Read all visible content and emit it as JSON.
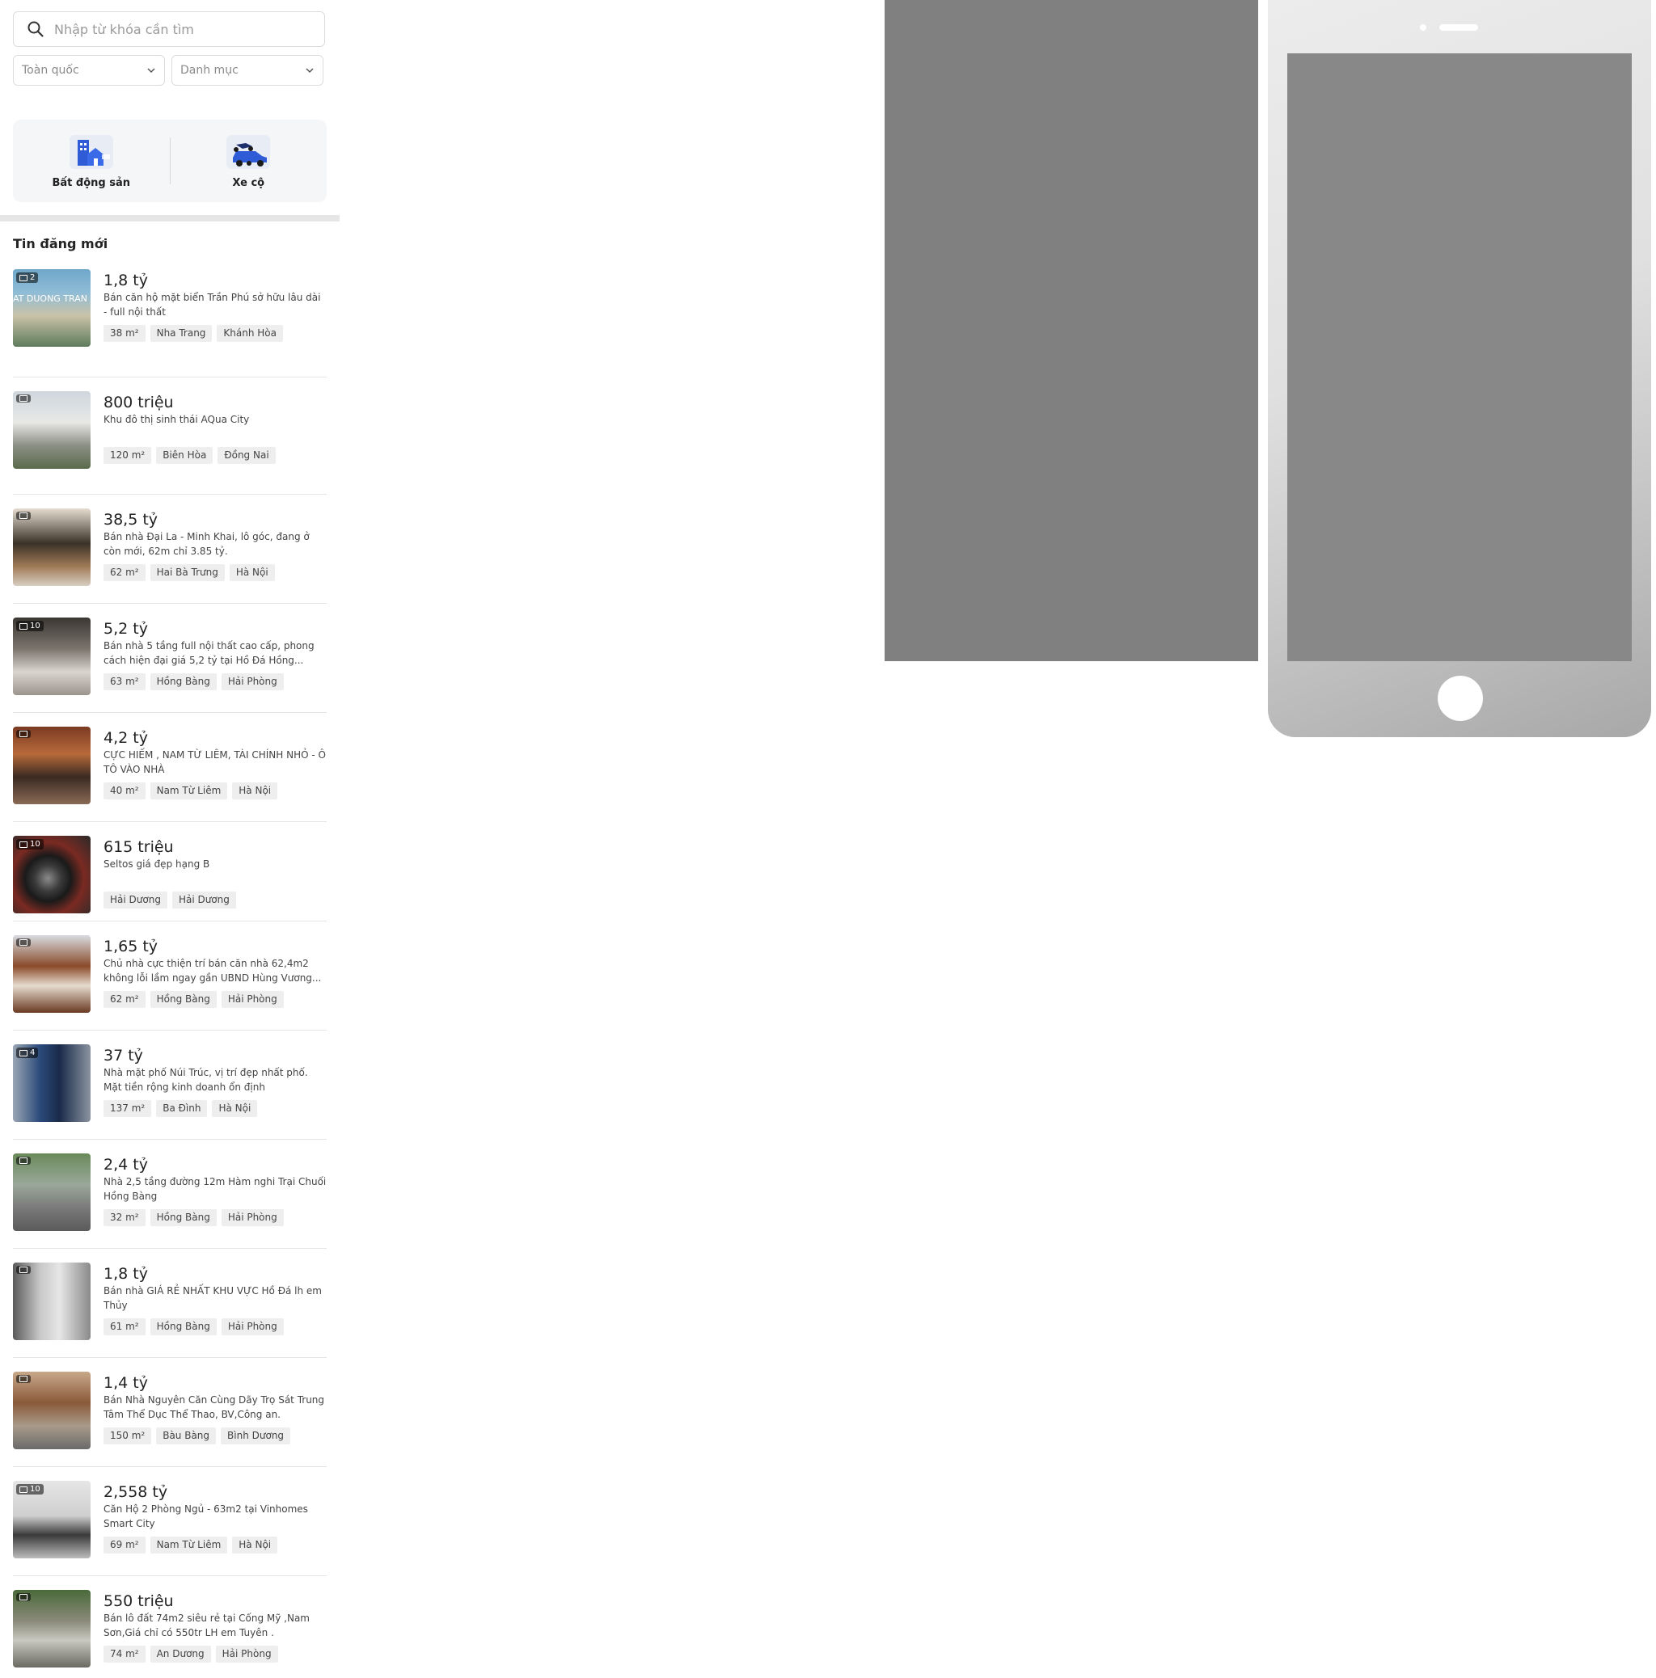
{
  "search": {
    "placeholder": "Nhập từ khóa cần tìm"
  },
  "filters": {
    "location": "Toàn quốc",
    "category": "Danh mục"
  },
  "categories": [
    {
      "label": "Bất động sản",
      "icon": "building-icon"
    },
    {
      "label": "Xe cộ",
      "icon": "vehicle-icon"
    }
  ],
  "section_title": "Tin đăng mới",
  "listings": [
    {
      "photos": "2",
      "price": "1,8 tỷ",
      "desc": "Bán căn hộ mặt biển Trần Phú sở hữu lâu dài - full nội thất",
      "tags": [
        "38 m²",
        "Nha Trang",
        "Khánh Hòa"
      ],
      "thumb_overlay": "AT DUONG TRAN PH"
    },
    {
      "photos": "",
      "price": "800 triệu",
      "desc": "Khu đô thị sinh thái AQua City",
      "tags": [
        "120 m²",
        "Biên Hòa",
        "Đồng Nai"
      ]
    },
    {
      "photos": "",
      "price": "38,5 tỷ",
      "desc": "Bán nhà Đại La - Minh Khai, lô góc, đang ở còn mới, 62m chỉ 3.85 tỷ.",
      "tags": [
        "62 m²",
        "Hai Bà Trưng",
        "Hà Nội"
      ]
    },
    {
      "photos": "10",
      "price": "5,2 tỷ",
      "desc": "Bán nhà 5 tầng full nội thất cao cấp, phong cách hiện đại giá 5,2 tỷ tại Hồ Đá Hồng...",
      "tags": [
        "63 m²",
        "Hồng Bàng",
        "Hải Phòng"
      ]
    },
    {
      "photos": "",
      "price": "4,2 tỷ",
      "desc": "CỰC HIẾM , NAM TỪ LIÊM, TÀI CHÍNH NHỎ - Ô TÔ VÀO NHÀ",
      "tags": [
        "40 m²",
        "Nam Từ Liêm",
        "Hà Nội"
      ]
    },
    {
      "photos": "10",
      "price": "615 triệu",
      "desc": "Seltos giá đẹp hạng B",
      "tags": [
        "Hải Dương",
        "Hải Dương"
      ]
    },
    {
      "photos": "",
      "price": "1,65 tỷ",
      "desc": "Chủ nhà cực thiện trí bán căn nhà 62,4m2 không lỗi lầm ngay gần UBND Hùng Vương...",
      "tags": [
        "62 m²",
        "Hồng Bàng",
        "Hải Phòng"
      ]
    },
    {
      "photos": "4",
      "price": "37 tỷ",
      "desc": "Nhà mặt phố Núi Trúc, vị trí đẹp nhất phố. Mặt tiền rộng kinh doanh ổn định",
      "tags": [
        "137 m²",
        "Ba Đình",
        "Hà Nội"
      ]
    },
    {
      "photos": "",
      "price": "2,4 tỷ",
      "desc": "Nhà 2,5 tầng đường 12m Hàm nghi Trại Chuối Hồng Bàng",
      "tags": [
        "32 m²",
        "Hồng Bàng",
        "Hải Phòng"
      ]
    },
    {
      "photos": "",
      "price": "1,8 tỷ",
      "desc": "Bán nhà GIÁ RẺ NHẤT KHU VỰC Hồ Đá lh em Thủy",
      "tags": [
        "61 m²",
        "Hồng Bàng",
        "Hải Phòng"
      ]
    },
    {
      "photos": "",
      "price": "1,4 tỷ",
      "desc": "Bán Nhà Nguyên Căn Cùng Dãy Trọ Sát Trung Tâm Thể Dục Thể Thao, BV,Công an.",
      "tags": [
        "150 m²",
        "Bàu Bàng",
        "Bình Dương"
      ]
    },
    {
      "photos": "10",
      "price": "2,558 tỷ",
      "desc": "Căn Hộ 2 Phòng Ngủ - 63m2 tại Vinhomes Smart City",
      "tags": [
        "69 m²",
        "Nam Từ Liêm",
        "Hà Nội"
      ]
    },
    {
      "photos": "",
      "price": "550 triệu",
      "desc": "Bán lô đất 74m2 siêu rẻ tại Cống Mỹ ,Nam Sơn,Giá chỉ có 550tr LH em Tuyên .",
      "tags": [
        "74 m²",
        "An Dương",
        "Hải Phòng"
      ]
    }
  ],
  "colors": {
    "accent": "#2f5bd6",
    "tag_bg": "#eeeeee",
    "panel_gray": "#808080"
  }
}
